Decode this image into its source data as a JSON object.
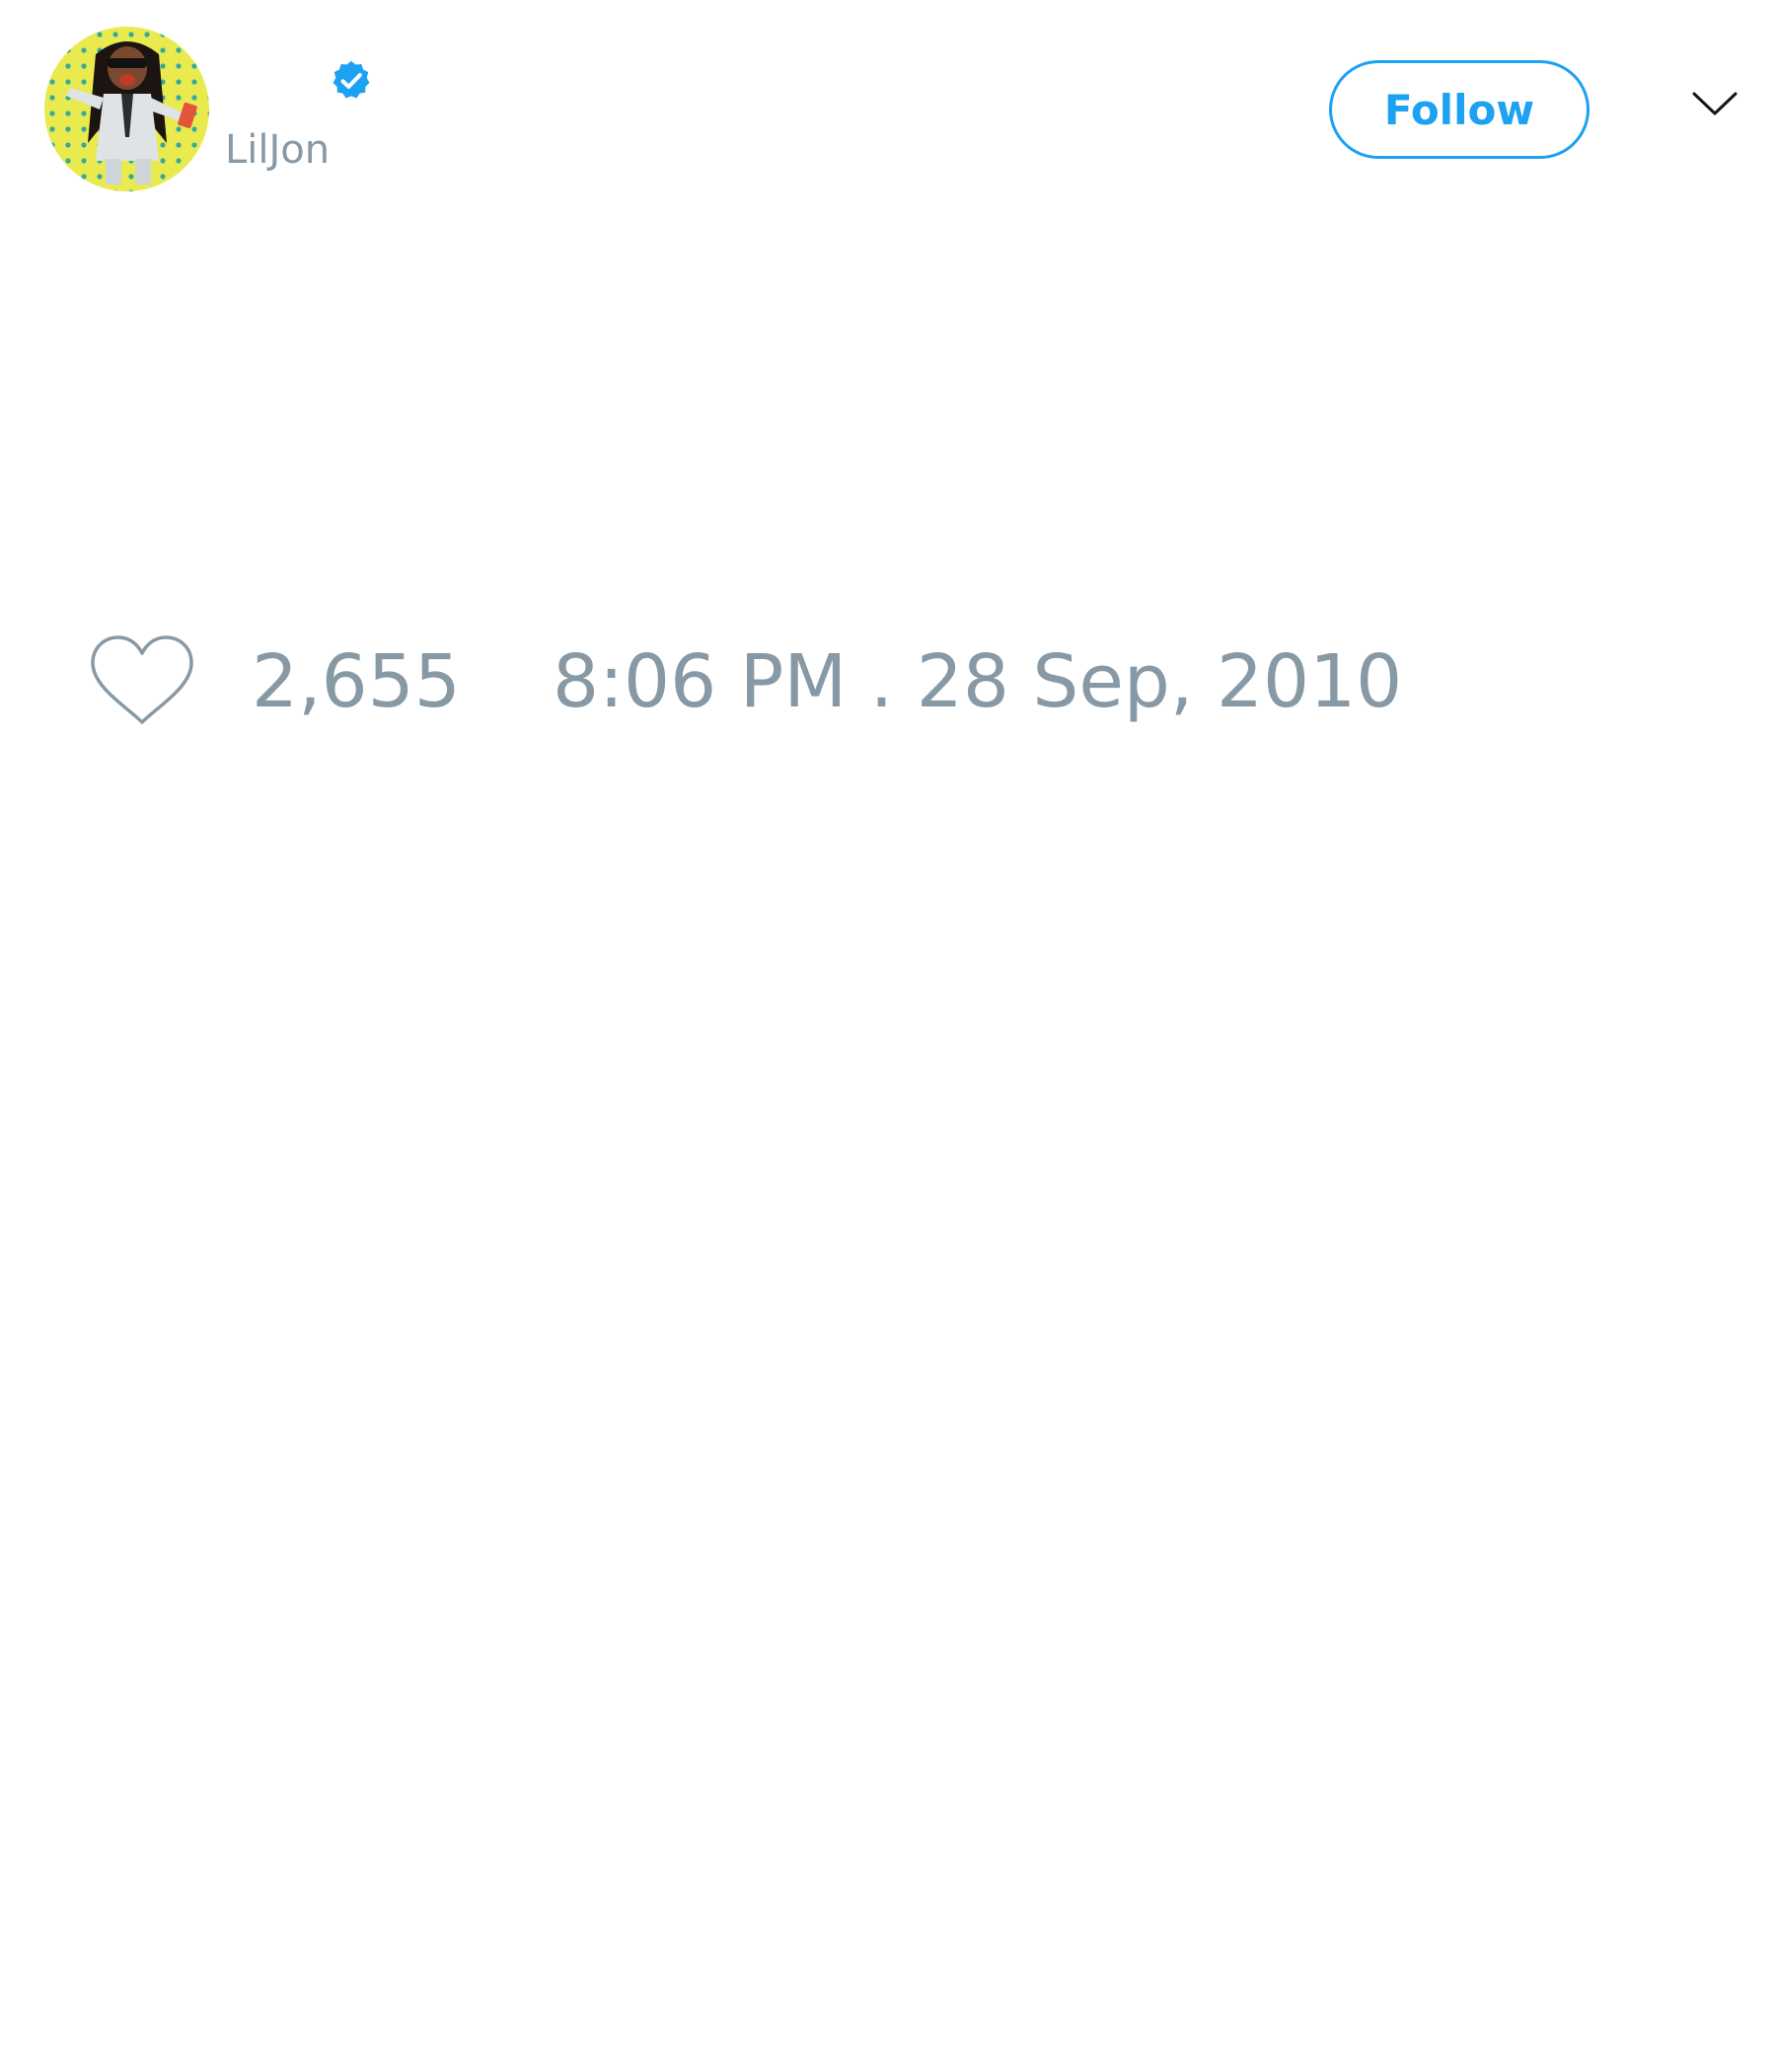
{
  "header": {
    "handle": "LilJon",
    "verified": true,
    "follow_label": "Follow",
    "menu_icon": "chevron-down-icon"
  },
  "avatar": {
    "icon": "user-avatar-photo"
  },
  "stats": {
    "like_icon": "heart-outline-icon",
    "like_count": "2,655",
    "timestamp": "8:06 PM . 28 Sep, 2010"
  },
  "colors": {
    "accent": "#1da1f2",
    "muted_text": "#8899a6",
    "background": "#ffffff"
  }
}
